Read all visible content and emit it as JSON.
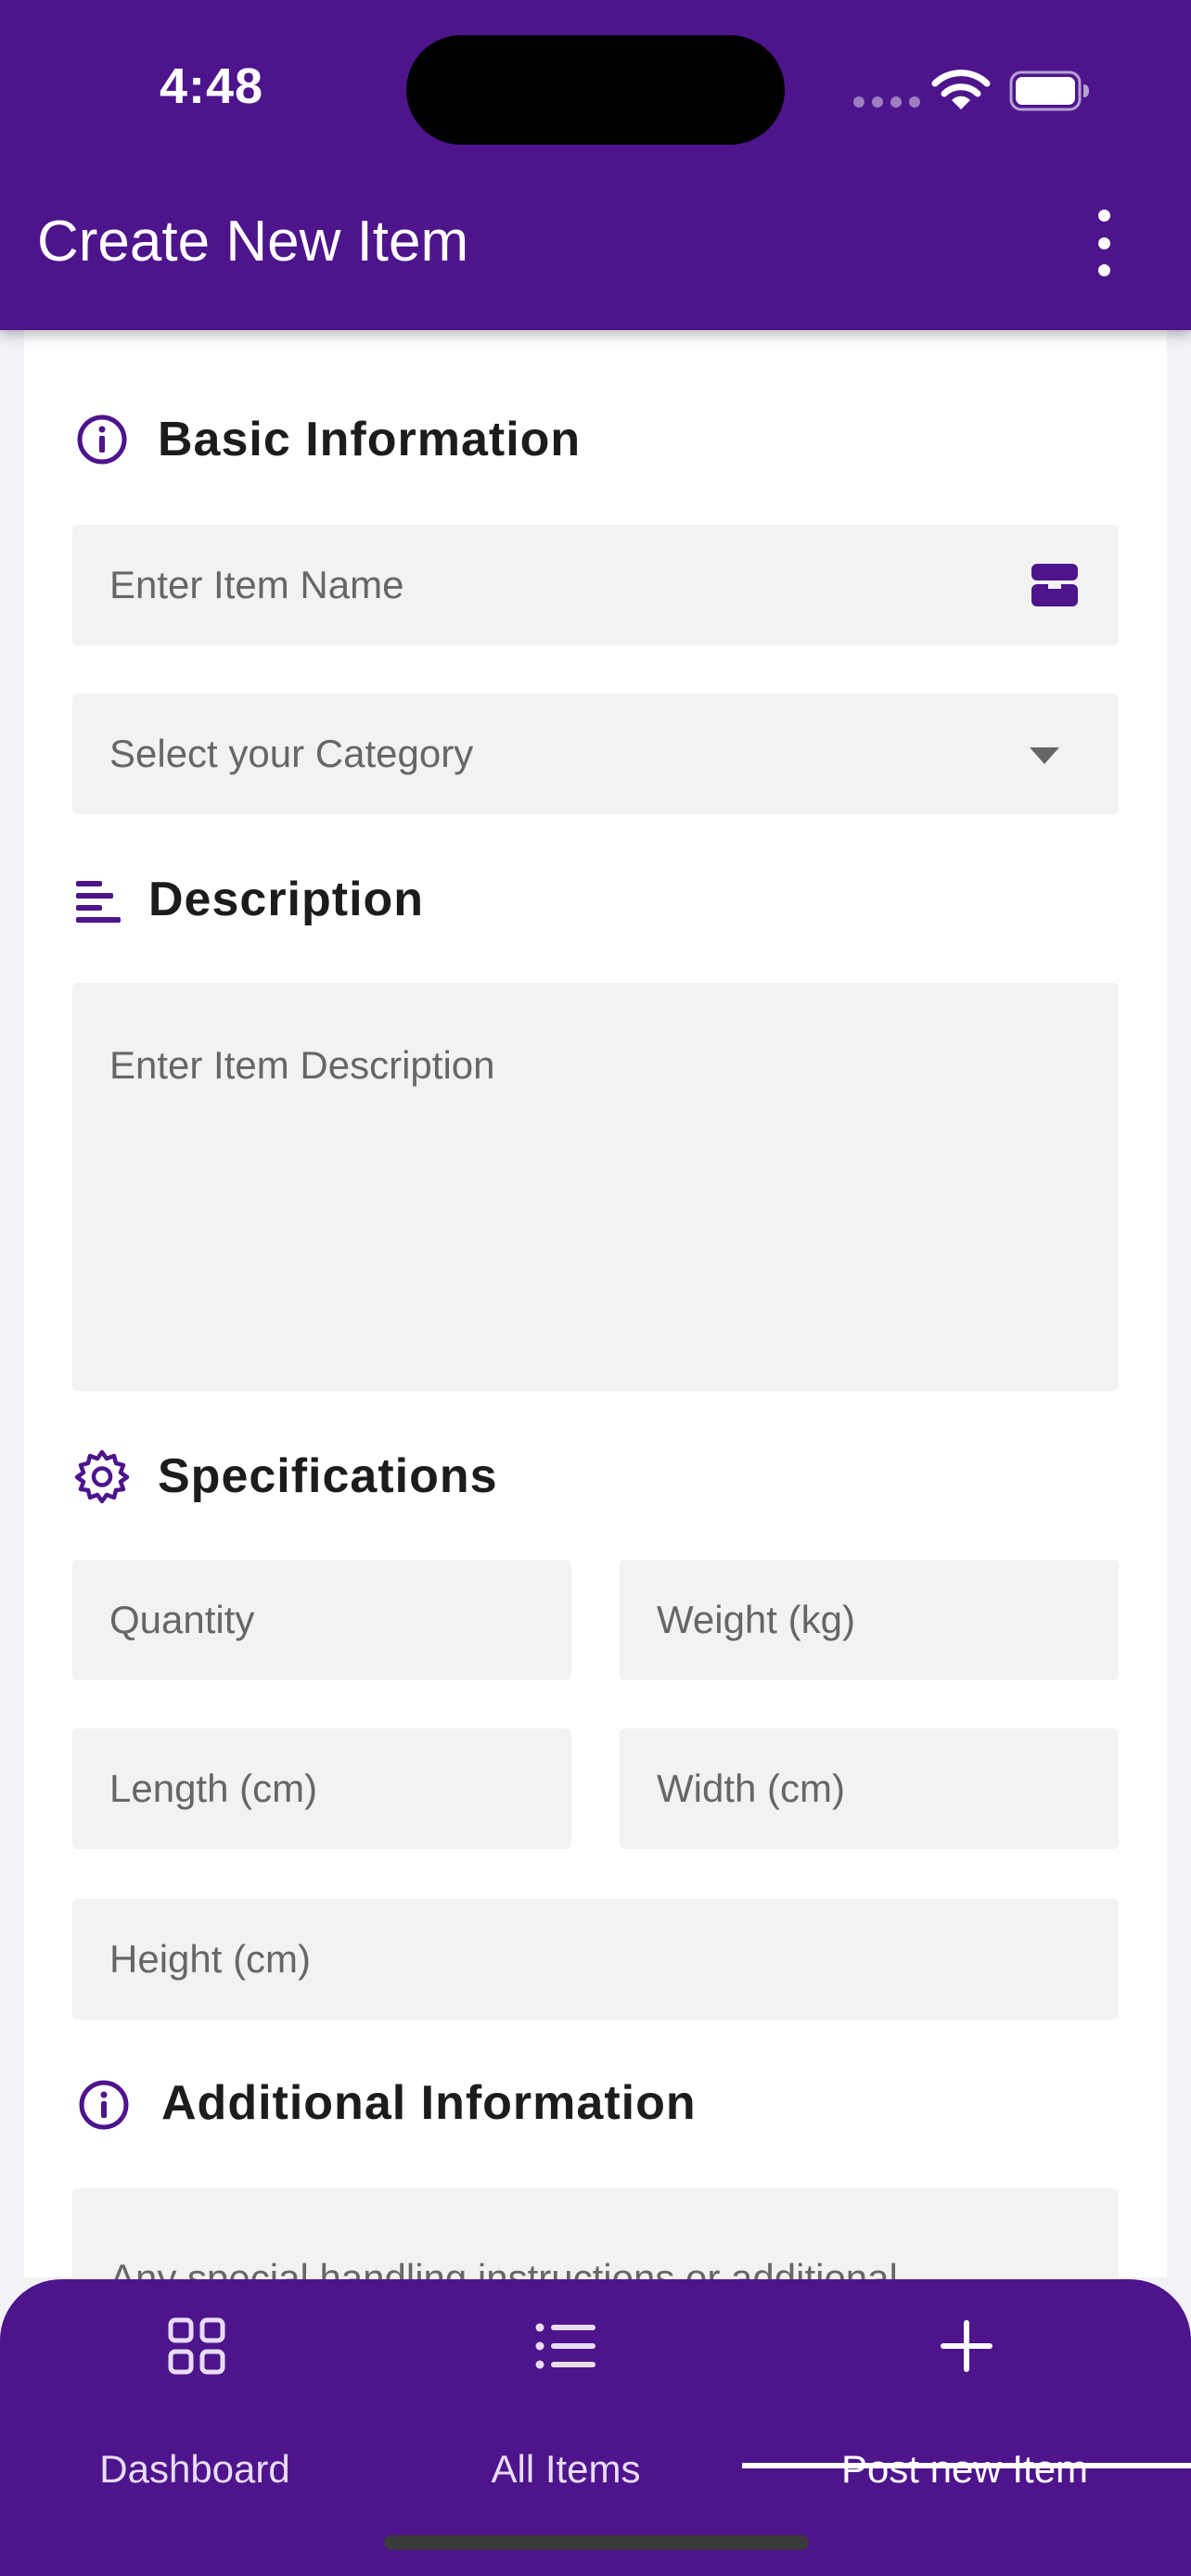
{
  "status_bar": {
    "time": "4:48"
  },
  "app_bar": {
    "title": "Create New Item",
    "menu_icon": "more-vertical-icon"
  },
  "sections": {
    "basic_info": {
      "title": "Basic Information",
      "icon": "info-circle-icon",
      "item_name_placeholder": "Enter Item Name",
      "item_name_icon": "box-icon",
      "category_placeholder": "Select your Category",
      "category_icon": "dropdown-arrow-icon"
    },
    "description": {
      "title": "Description",
      "icon": "align-left-icon",
      "placeholder": "Enter Item Description"
    },
    "specifications": {
      "title": "Specifications",
      "icon": "gear-icon",
      "quantity_placeholder": "Quantity",
      "weight_placeholder": "Weight (kg)",
      "length_placeholder": "Length (cm)",
      "width_placeholder": "Width (cm)",
      "height_placeholder": "Height (cm)"
    },
    "additional_info": {
      "title": "Additional Information",
      "icon": "info-circle-icon",
      "placeholder": "Any special handling instructions or additional"
    }
  },
  "bottom_nav": {
    "items": [
      {
        "label": "Dashboard",
        "icon": "grid-icon",
        "active": false
      },
      {
        "label": "All Items",
        "icon": "list-icon",
        "active": false
      },
      {
        "label": "Post new Item",
        "icon": "plus-icon",
        "active": true
      }
    ]
  },
  "colors": {
    "primary": "#4d148c",
    "field_background": "#f2f2f2",
    "page_background": "#f2f2f7",
    "placeholder_text": "#666666"
  }
}
